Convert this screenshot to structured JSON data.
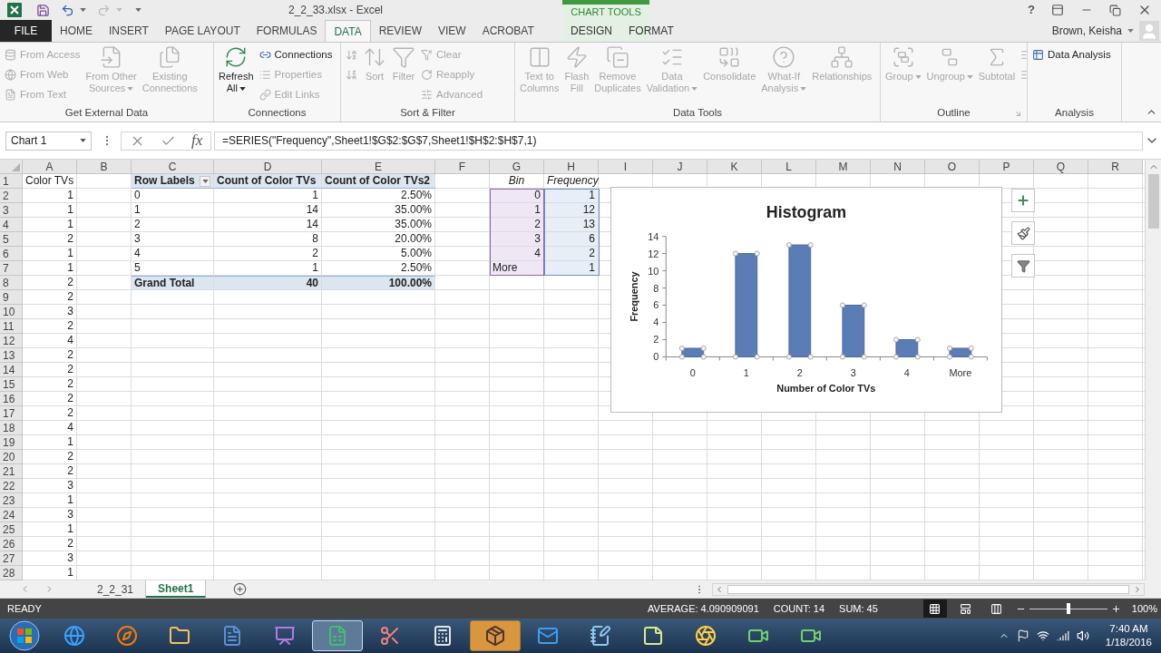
{
  "window": {
    "title": "2_2_33.xlsx - Excel",
    "help": "?",
    "user": "Brown, Keisha"
  },
  "contextual_group": "CHART TOOLS",
  "tabs": [
    {
      "label": "FILE",
      "kind": "file",
      "selected": false
    },
    {
      "label": "HOME",
      "kind": "main",
      "selected": false
    },
    {
      "label": "INSERT",
      "kind": "main",
      "selected": false
    },
    {
      "label": "PAGE LAYOUT",
      "kind": "main",
      "selected": false
    },
    {
      "label": "FORMULAS",
      "kind": "main",
      "selected": false
    },
    {
      "label": "DATA",
      "kind": "main",
      "selected": true
    },
    {
      "label": "REVIEW",
      "kind": "main",
      "selected": false
    },
    {
      "label": "VIEW",
      "kind": "main",
      "selected": false
    },
    {
      "label": "ACROBAT",
      "kind": "main",
      "selected": false
    },
    {
      "label": "DESIGN",
      "kind": "contextual",
      "selected": false
    },
    {
      "label": "FORMAT",
      "kind": "contextual",
      "selected": false
    }
  ],
  "ribbon_groups": [
    {
      "label": "Get External Data",
      "launcher": false,
      "items": [
        {
          "kind": "small",
          "label": "From Access",
          "disabled": true
        },
        {
          "kind": "small",
          "label": "From Web",
          "disabled": true
        },
        {
          "kind": "small",
          "label": "From Text",
          "disabled": true
        },
        {
          "kind": "large",
          "label": "From Other\nSources",
          "dropdown": true,
          "disabled": true
        },
        {
          "kind": "large",
          "label": "Existing\nConnections",
          "dropdown": false,
          "disabled": true
        }
      ]
    },
    {
      "label": "Connections",
      "launcher": false,
      "items": [
        {
          "kind": "large",
          "label": "Refresh\nAll",
          "dropdown": true,
          "disabled": false
        },
        {
          "kind": "small",
          "label": "Connections",
          "disabled": false
        },
        {
          "kind": "small",
          "label": "Properties",
          "disabled": true
        },
        {
          "kind": "small",
          "label": "Edit Links",
          "disabled": true
        }
      ]
    },
    {
      "label": "Sort & Filter",
      "launcher": false,
      "items": [
        {
          "kind": "small",
          "disabled": true
        },
        {
          "kind": "small",
          "disabled": true
        },
        {
          "kind": "large",
          "label": "Sort",
          "dropdown": false,
          "disabled": true
        },
        {
          "kind": "large",
          "label": "Filter",
          "dropdown": false,
          "disabled": true
        },
        {
          "kind": "small",
          "label": "Clear",
          "disabled": true
        },
        {
          "kind": "small",
          "label": "Reapply",
          "disabled": true
        },
        {
          "kind": "small",
          "label": "Advanced",
          "disabled": true
        }
      ]
    },
    {
      "label": "Data Tools",
      "launcher": false,
      "items": [
        {
          "kind": "large",
          "label": "Text to\nColumns",
          "dropdown": false,
          "disabled": true
        },
        {
          "kind": "large",
          "label": "Flash\nFill",
          "dropdown": false,
          "disabled": true
        },
        {
          "kind": "large",
          "label": "Remove\nDuplicates",
          "dropdown": false,
          "disabled": true
        },
        {
          "kind": "large",
          "label": "Data\nValidation",
          "dropdown": true,
          "disabled": true
        },
        {
          "kind": "large",
          "label": "Consolidate",
          "dropdown": false,
          "disabled": true
        },
        {
          "kind": "large",
          "label": "What-If\nAnalysis",
          "dropdown": true,
          "disabled": true
        },
        {
          "kind": "large",
          "label": "Relationships",
          "dropdown": false,
          "disabled": true
        }
      ]
    },
    {
      "label": "Outline",
      "launcher": true,
      "items": [
        {
          "kind": "large",
          "label": "Group",
          "dropdown": true,
          "disabled": true
        },
        {
          "kind": "large",
          "label": "Ungroup",
          "dropdown": true,
          "disabled": true
        },
        {
          "kind": "large",
          "label": "Subtotal",
          "dropdown": false,
          "disabled": true
        },
        {
          "kind": "small",
          "disabled": true
        },
        {
          "kind": "small",
          "disabled": true
        }
      ]
    },
    {
      "label": "Analysis",
      "launcher": false,
      "items": [
        {
          "kind": "small",
          "label": "Data Analysis",
          "disabled": false
        }
      ]
    }
  ],
  "formula_bar": {
    "name_box": "Chart 1",
    "function_label": "fx",
    "formula": "=SERIES(\"Frequency\",Sheet1!$G$2:$G$7,Sheet1!$H$2:$H$7,1)"
  },
  "grid": {
    "columns": [
      "A",
      "B",
      "C",
      "D",
      "E",
      "F",
      "G",
      "H",
      "I",
      "J",
      "K",
      "L",
      "M",
      "N",
      "O",
      "P",
      "Q",
      "R"
    ],
    "row_numbers": [
      "1",
      "2",
      "3",
      "4",
      "5",
      "6",
      "7",
      "8",
      "9",
      "10",
      "11",
      "12",
      "13",
      "14",
      "15",
      "16",
      "17",
      "18",
      "19",
      "20",
      "21",
      "22",
      "23",
      "24",
      "25",
      "26",
      "27",
      "28"
    ]
  },
  "column_a": {
    "header": "Color TVs",
    "values": [
      "1",
      "1",
      "1",
      "2",
      "1",
      "1",
      "2",
      "2",
      "3",
      "2",
      "4",
      "2",
      "2",
      "2",
      "2",
      "2",
      "4",
      "1",
      "2",
      "2",
      "3",
      "1",
      "3",
      "1",
      "2",
      "3",
      "1"
    ]
  },
  "pivot_table": {
    "headers": [
      "Row Labels",
      "Count of Color TVs",
      "Count of Color TVs2"
    ],
    "rows": [
      [
        "0",
        "1",
        "2.50%"
      ],
      [
        "1",
        "14",
        "35.00%"
      ],
      [
        "2",
        "14",
        "35.00%"
      ],
      [
        "3",
        "8",
        "20.00%"
      ],
      [
        "4",
        "2",
        "5.00%"
      ],
      [
        "5",
        "1",
        "2.50%"
      ]
    ],
    "total": [
      "Grand Total",
      "40",
      "100.00%"
    ]
  },
  "bin_table": {
    "headers": [
      "Bin",
      "Frequency"
    ],
    "rows": [
      [
        "0",
        "1"
      ],
      [
        "1",
        "12"
      ],
      [
        "2",
        "13"
      ],
      [
        "3",
        "6"
      ],
      [
        "4",
        "2"
      ],
      [
        "More",
        "1"
      ]
    ]
  },
  "chart": {
    "chart_data": {
      "type": "bar",
      "title": "Histogram",
      "xlabel": "Number of Color TVs",
      "ylabel": "Frequency",
      "categories": [
        "0",
        "1",
        "2",
        "3",
        "4",
        "More"
      ],
      "values": [
        1,
        12,
        13,
        6,
        2,
        1
      ],
      "ylim": [
        0,
        14
      ],
      "yticks": [
        0,
        2,
        4,
        6,
        8,
        10,
        12,
        14
      ]
    }
  },
  "sheet_tabs": [
    {
      "label": "2_2_31",
      "selected": false
    },
    {
      "label": "Sheet1",
      "selected": true
    }
  ],
  "status_bar": {
    "mode": "READY",
    "average": "AVERAGE: 4.090909091",
    "count": "COUNT: 14",
    "sum": "SUM: 45",
    "views": [
      {
        "selected": true
      },
      {
        "selected": false
      },
      {
        "selected": false
      }
    ],
    "zoom_slider": {
      "level": 0.5
    },
    "zoom": "100%"
  },
  "taskbar": {
    "apps": [
      {
        "kind": "browser",
        "selected": false,
        "highlighted": false
      },
      {
        "kind": "browser2",
        "selected": false,
        "highlighted": false
      },
      {
        "kind": "folder",
        "selected": false,
        "highlighted": false
      },
      {
        "kind": "document",
        "selected": false,
        "highlighted": false
      },
      {
        "kind": "presentation",
        "selected": false,
        "highlighted": false
      },
      {
        "kind": "spreadsheet",
        "selected": true,
        "highlighted": false
      },
      {
        "kind": "scissors",
        "selected": false,
        "highlighted": false
      },
      {
        "kind": "calculator",
        "selected": false,
        "highlighted": false
      },
      {
        "kind": "package",
        "selected": false,
        "highlighted": true
      },
      {
        "kind": "mail",
        "selected": false,
        "highlighted": false
      },
      {
        "kind": "notepad",
        "selected": false,
        "highlighted": false
      },
      {
        "kind": "sticky",
        "selected": false,
        "highlighted": false
      },
      {
        "kind": "browser3",
        "selected": false,
        "highlighted": false
      },
      {
        "kind": "recorder",
        "selected": false,
        "highlighted": false
      },
      {
        "kind": "recorder",
        "selected": false,
        "highlighted": false
      }
    ],
    "time": "7:40 AM",
    "date": "1/18/2016"
  }
}
